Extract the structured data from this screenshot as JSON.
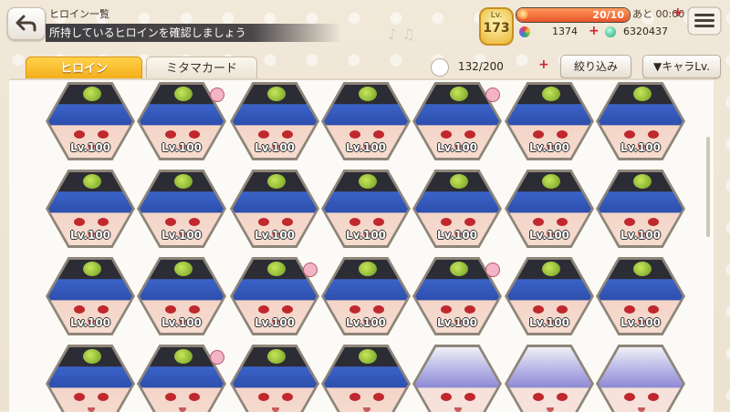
{
  "header": {
    "title": "ヒロイン一覧",
    "subtitle": "所持しているヒロインを確認しましょう"
  },
  "status": {
    "level_label": "Lv.",
    "level": "173",
    "stamina": "20/10",
    "stamina_fill_fraction": 1.0,
    "recover_label": "あと",
    "recover_time": "00:00",
    "currency1": "1374",
    "currency2": "6320437",
    "plus": "+"
  },
  "tabs": [
    {
      "label": "ヒロイン",
      "active": true
    },
    {
      "label": "ミタマカード",
      "active": false
    }
  ],
  "inventory": {
    "count": "132/200",
    "plus": "+"
  },
  "buttons": {
    "filter": "絞り込み",
    "sort": "▼キャラLv."
  },
  "grid": {
    "rows": [
      [
        {
          "level": "Lv.100",
          "style": "blue",
          "pinned": false
        },
        {
          "level": "Lv.100",
          "style": "blue",
          "pinned": true
        },
        {
          "level": "Lv.100",
          "style": "blue",
          "pinned": false
        },
        {
          "level": "Lv.100",
          "style": "blue",
          "pinned": false
        },
        {
          "level": "Lv.100",
          "style": "blue",
          "pinned": true
        },
        {
          "level": "Lv.100",
          "style": "blue",
          "pinned": false
        },
        {
          "level": "Lv.100",
          "style": "blue",
          "pinned": false
        }
      ],
      [
        {
          "level": "Lv.100",
          "style": "blue",
          "pinned": false
        },
        {
          "level": "Lv.100",
          "style": "blue",
          "pinned": false
        },
        {
          "level": "Lv.100",
          "style": "blue",
          "pinned": false
        },
        {
          "level": "Lv.100",
          "style": "blue",
          "pinned": false
        },
        {
          "level": "Lv.100",
          "style": "blue",
          "pinned": false
        },
        {
          "level": "Lv.100",
          "style": "blue",
          "pinned": false
        },
        {
          "level": "Lv.100",
          "style": "blue",
          "pinned": false
        }
      ],
      [
        {
          "level": "Lv.100",
          "style": "blue",
          "pinned": false
        },
        {
          "level": "Lv.100",
          "style": "blue",
          "pinned": false
        },
        {
          "level": "Lv.100",
          "style": "blue",
          "pinned": true
        },
        {
          "level": "Lv.100",
          "style": "blue",
          "pinned": false
        },
        {
          "level": "Lv.100",
          "style": "blue",
          "pinned": true
        },
        {
          "level": "Lv.100",
          "style": "blue",
          "pinned": false
        },
        {
          "level": "Lv.100",
          "style": "blue",
          "pinned": false
        }
      ],
      [
        {
          "level": "",
          "style": "blue",
          "pinned": false
        },
        {
          "level": "",
          "style": "blue",
          "pinned": true
        },
        {
          "level": "",
          "style": "blue",
          "pinned": false
        },
        {
          "level": "",
          "style": "blue",
          "pinned": false
        },
        {
          "level": "",
          "style": "purple",
          "pinned": false
        },
        {
          "level": "",
          "style": "purple",
          "pinned": false
        },
        {
          "level": "",
          "style": "purple",
          "pinned": false
        }
      ]
    ]
  },
  "colors": {
    "active_tab": "#f2a914",
    "stamina": "#e8552a",
    "plus": "#d0232d"
  }
}
